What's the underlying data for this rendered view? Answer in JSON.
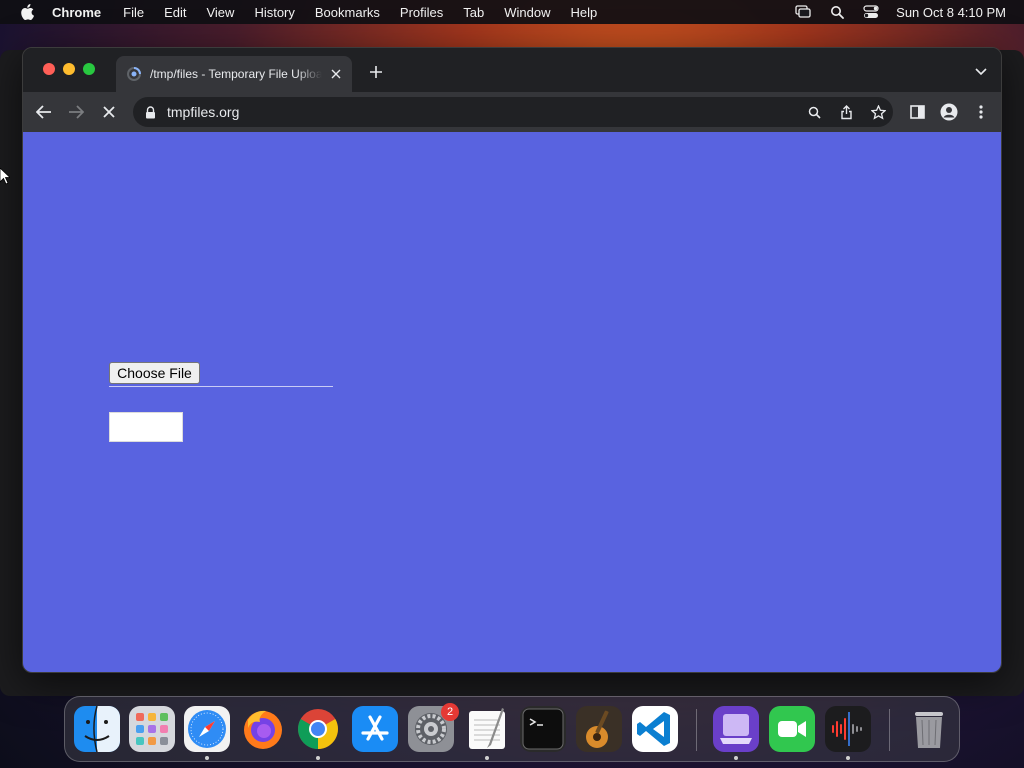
{
  "menubar": {
    "app_name": "Chrome",
    "items": [
      "File",
      "Edit",
      "View",
      "History",
      "Bookmarks",
      "Profiles",
      "Tab",
      "Window",
      "Help"
    ],
    "clock": "Sun Oct 8  4:10 PM"
  },
  "browser": {
    "tab_title": "/tmp/files - Temporary File Upload",
    "url": "tmpfiles.org",
    "loading": true
  },
  "page": {
    "background_color": "#5963e0",
    "file_button_label": "Choose File",
    "submit_button_label": ""
  },
  "dock": {
    "apps": [
      "Finder",
      "Launchpad",
      "Safari",
      "Firefox",
      "Google Chrome",
      "App Store",
      "System Settings",
      "TextEdit",
      "Terminal",
      "GarageBand",
      "Visual Studio Code",
      "Simulator",
      "FaceTime",
      "Voice Memos",
      "Trash"
    ],
    "system_settings_badge": "2"
  }
}
